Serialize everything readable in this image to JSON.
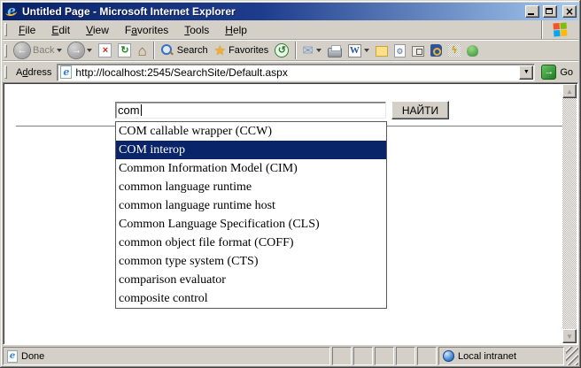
{
  "window": {
    "title": "Untitled Page - Microsoft Internet Explorer"
  },
  "menu": {
    "items": [
      {
        "label": "File",
        "underline_index": 0
      },
      {
        "label": "Edit",
        "underline_index": 0
      },
      {
        "label": "View",
        "underline_index": 0
      },
      {
        "label": "Favorites",
        "underline_index": 1
      },
      {
        "label": "Tools",
        "underline_index": 0
      },
      {
        "label": "Help",
        "underline_index": 0
      }
    ]
  },
  "toolbar": {
    "back_label": "Back",
    "search_label": "Search",
    "favorites_label": "Favorites"
  },
  "address": {
    "label": "Address",
    "underline_index": 1,
    "url": "http://localhost:2545/SearchSite/Default.aspx",
    "go_label": "Go"
  },
  "page": {
    "search_value": "com",
    "find_button_label": "НАЙТИ",
    "suggestions": [
      "COM callable wrapper (CCW)",
      "COM interop",
      "Common Information Model (CIM)",
      "common language runtime",
      "common language runtime host",
      "Common Language Specification (CLS)",
      "common object file format (COFF)",
      "common type system (CTS)",
      "comparison evaluator",
      "composite control"
    ],
    "selected_suggestion_index": 1
  },
  "status": {
    "message": "Done",
    "zone_label": "Local intranet",
    "small_panel_count": 5
  },
  "icons": {
    "ie_e": "e",
    "back_arrow": "←",
    "forward_arrow": "→",
    "stop_x": "×",
    "refresh_arrow": "↻",
    "home_house": "⌂",
    "favorites_star": "★",
    "history_arrow": "↺",
    "mail_envelope": "✉",
    "word_w": "W",
    "page_gear": "⚙",
    "grid_lightning": "ϟ",
    "go_arrow": "→",
    "dropdown_arrow": "▼",
    "scroll_up": "▲",
    "scroll_down": "▼",
    "close_x": "×"
  },
  "colors": {
    "chrome": "#d4d0c8",
    "title_gradient_start": "#0a246a",
    "title_gradient_end": "#a6caf0",
    "selection": "#0a246a",
    "go_green": "#1e7e1e",
    "favorites_gold": "#f2ae2c",
    "stop_red": "#d42020",
    "refresh_green": "#1f8a1f"
  }
}
